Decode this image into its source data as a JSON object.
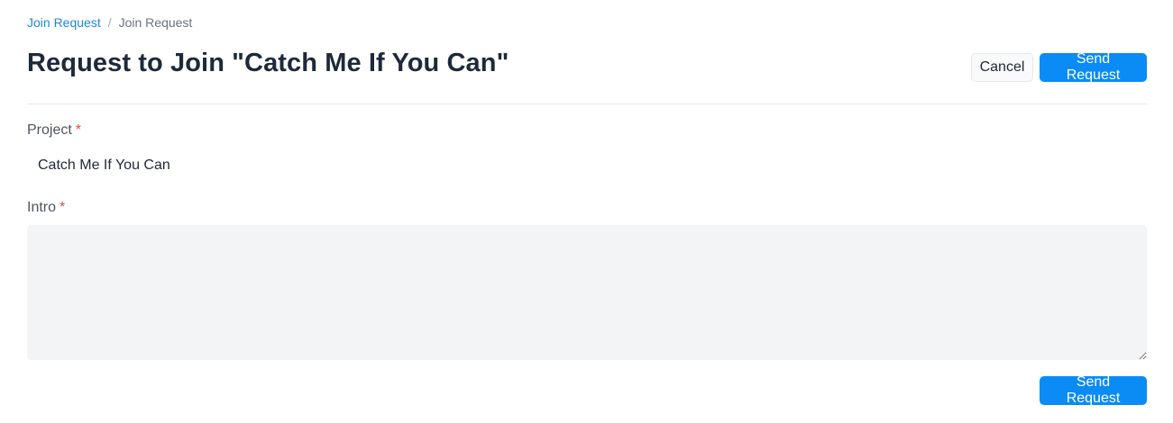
{
  "breadcrumb": {
    "parent_label": "Join Request",
    "separator": "/",
    "current_label": "Join Request"
  },
  "header": {
    "title": "Request to Join \"Catch Me If You Can\"",
    "cancel_label": "Cancel",
    "send_label": "Send Request"
  },
  "form": {
    "project": {
      "label": "Project",
      "required_mark": "*",
      "value": "Catch Me If You Can"
    },
    "intro": {
      "label": "Intro",
      "required_mark": "*",
      "value": "",
      "placeholder": ""
    }
  },
  "footer": {
    "send_label": "Send Request"
  },
  "colors": {
    "primary": "#0a8bf5",
    "link": "#1a86e8",
    "required": "#ef4444",
    "textarea_bg": "#f3f4f6"
  }
}
